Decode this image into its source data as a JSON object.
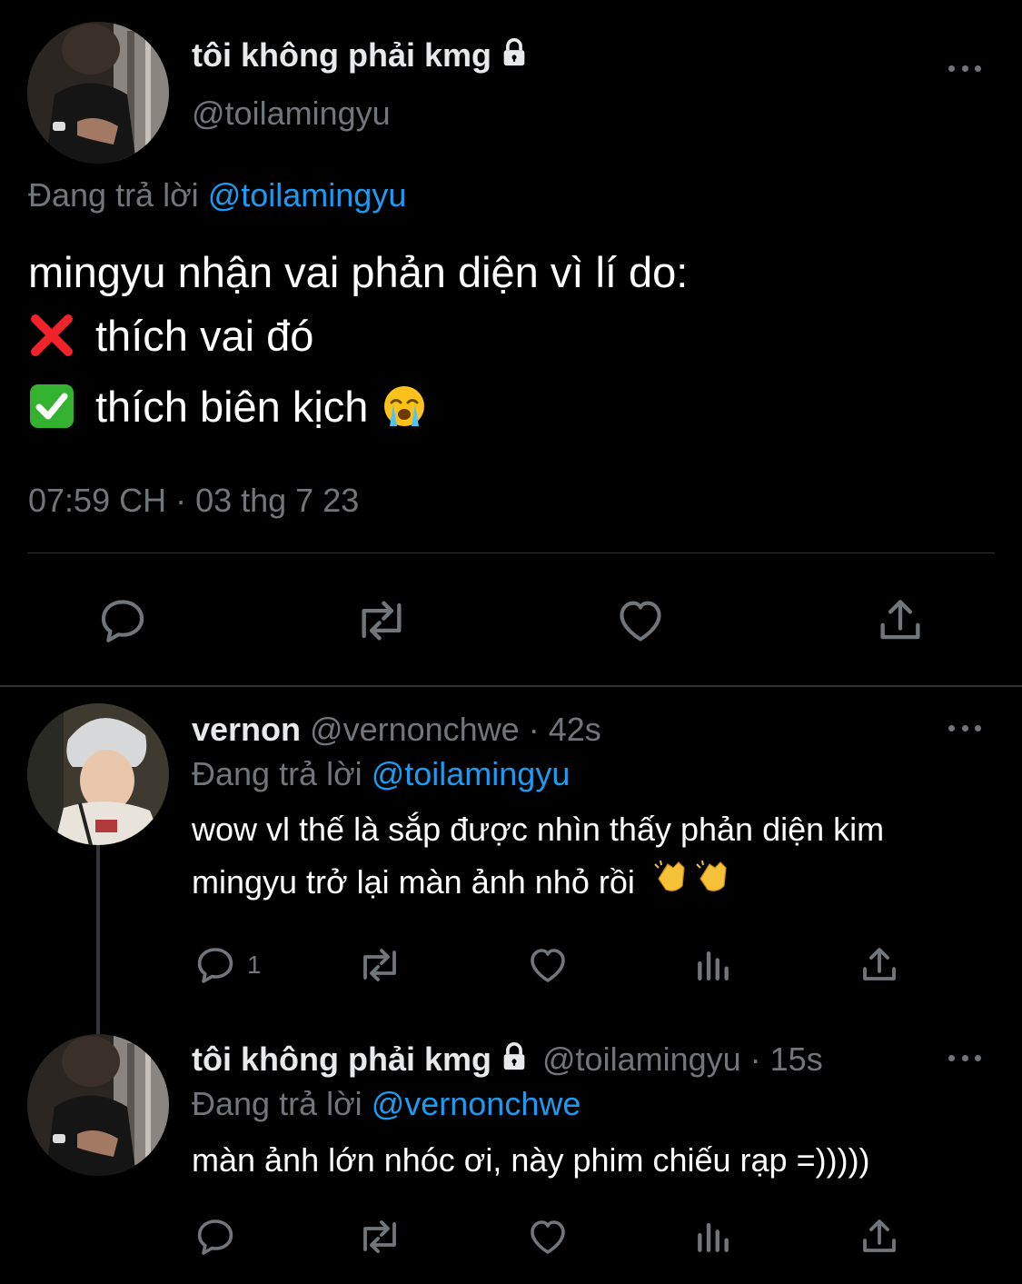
{
  "main_tweet": {
    "author_name": "tôi không phải kmg",
    "author_handle": "@toilamingyu",
    "replying_prefix": "Đang trả lời",
    "replying_to": "@toilamingyu",
    "line1": "mingyu nhận vai phản diện vì lí do:",
    "line2": "thích vai đó",
    "line3": "thích biên kịch",
    "line2_emoji": "cross-mark-emoji",
    "line3_emoji": "check-mark-emoji",
    "line3_trailing_emoji": "loudly-crying-face-emoji",
    "timestamp": "07:59 CH · 03 thg 7 23",
    "actions": [
      "reply-icon",
      "retweet-icon",
      "like-icon",
      "share-icon"
    ]
  },
  "replies": [
    {
      "author_name": "vernon",
      "author_handle": "@vernonchwe",
      "time": "· 42s",
      "replying_prefix": "Đang trả lời",
      "replying_to": "@toilamingyu",
      "text_line1": "wow vl thế là sắp được nhìn thấy phản diện kim",
      "text_line2": "mingyu trở lại màn ảnh nhỏ rồi",
      "trailing_emoji": "clapping-hands-emoji",
      "reply_count": "1"
    },
    {
      "author_name": "tôi không phải kmg",
      "author_handle": "@toilamingyu",
      "time": "· 15s",
      "replying_prefix": "Đang trả lời",
      "replying_to": "@vernonchwe",
      "text_line1": "màn ảnh lớn nhóc ơi, này phim chiếu rạp =)))))"
    }
  ],
  "colors": {
    "background": "#000000",
    "text": "#e7e9ea",
    "muted": "#71767b",
    "link": "#1d9bf0",
    "divider": "#2f3336"
  }
}
